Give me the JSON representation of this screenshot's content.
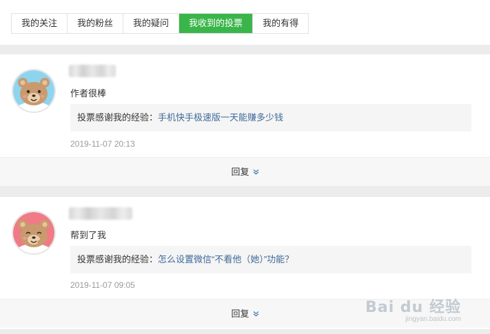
{
  "tabs": [
    {
      "label": "我的关注",
      "active": false
    },
    {
      "label": "我的粉丝",
      "active": false
    },
    {
      "label": "我的疑问",
      "active": false
    },
    {
      "label": "我收到的投票",
      "active": true
    },
    {
      "label": "我的有得",
      "active": false
    }
  ],
  "entries": [
    {
      "comment": "作者很棒",
      "quote_prefix": "投票感谢我的经验：",
      "quote_link": "手机快手极速版一天能赚多少钱",
      "time": "2019-11-07 20:13",
      "reply_label": "回复",
      "avatar_bg": "#8fd4ee"
    },
    {
      "comment": "帮到了我",
      "quote_prefix": "投票感谢我的经验：",
      "quote_link": "怎么设置微信“不看他（她）”功能？",
      "time": "2019-11-07 09:05",
      "reply_label": "回复",
      "avatar_bg": "#f07a86"
    }
  ],
  "icons": {
    "reply_chevron": "chevron-double-down-icon",
    "avatar": "bear-avatar-icon"
  },
  "watermark": {
    "logo": "Bai du 经验",
    "url": "jingyan.baidu.com"
  },
  "colors": {
    "accent_green": "#3ab54a",
    "link_blue": "#3f6a99"
  }
}
